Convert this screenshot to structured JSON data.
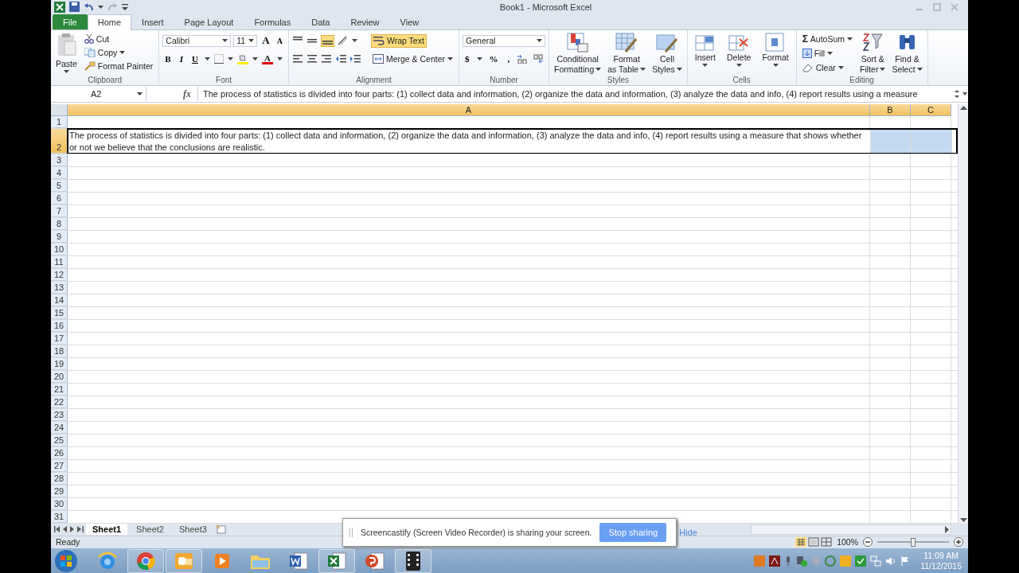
{
  "window": {
    "title": "Book1  -  Microsoft Excel"
  },
  "tabs": [
    {
      "label": "File",
      "kind": "file",
      "selected": false
    },
    {
      "label": "Home",
      "kind": "tab",
      "selected": true
    },
    {
      "label": "Insert",
      "kind": "tab",
      "selected": false
    },
    {
      "label": "Page Layout",
      "kind": "tab",
      "selected": false
    },
    {
      "label": "Formulas",
      "kind": "tab",
      "selected": false
    },
    {
      "label": "Data",
      "kind": "tab",
      "selected": false
    },
    {
      "label": "Review",
      "kind": "tab",
      "selected": false
    },
    {
      "label": "View",
      "kind": "tab",
      "selected": false
    }
  ],
  "ribbon": {
    "groups": [
      {
        "kind": "clipboard",
        "label": "Clipboard",
        "paste": {
          "label": "Paste",
          "disabled": true
        },
        "items": [
          "Cut",
          "Copy",
          "Format Painter"
        ]
      },
      {
        "kind": "font",
        "label": "Font",
        "font_name": "Calibri",
        "font_size": "11",
        "grow": "A",
        "shrink": "A",
        "bold": "B",
        "italic": "I",
        "underline": "U",
        "font_color": "A"
      },
      {
        "kind": "alignment",
        "label": "Alignment",
        "bottom_align_on": true,
        "wrap_text": {
          "label": "Wrap Text",
          "on": true
        },
        "merge": "Merge & Center"
      },
      {
        "kind": "number",
        "label": "Number",
        "format": "General",
        "currency": "$",
        "percent": "%",
        "comma": ","
      },
      {
        "kind": "styles",
        "label": "Styles",
        "items": [
          [
            "Conditional",
            "Formatting"
          ],
          [
            "Format",
            "as Table"
          ],
          [
            "Cell",
            "Styles"
          ]
        ]
      },
      {
        "kind": "cells",
        "label": "Cells",
        "items": [
          "Insert",
          "Delete",
          "Format"
        ]
      },
      {
        "kind": "editing",
        "label": "Editing",
        "sum_symbol": "Σ",
        "small": [
          "AutoSum",
          "Fill",
          "Clear"
        ],
        "large": [
          [
            "Sort &",
            "Filter"
          ],
          [
            "Find &",
            "Select"
          ]
        ]
      }
    ]
  },
  "formula_bar": {
    "name_box": "A2",
    "fx": "fx",
    "formula": "The process of statistics is divided into four parts: (1) collect data and information, (2) organize the data and information, (3) analyze the data and info, (4) report results using a measure"
  },
  "columns": [
    {
      "label": "A",
      "selected": true
    },
    {
      "label": "B",
      "selected": true
    },
    {
      "label": "C",
      "selected": true
    }
  ],
  "rows": [
    {
      "header": "1",
      "selected": false
    },
    {
      "header": "2",
      "selected": true,
      "tall": true,
      "cells": [
        {
          "text": "The process of statistics is divided into four parts: (1) collect data and information, (2) organize the data and information, (3) analyze the data and info, (4) report results using a measure that shows whether or not we believe that the conclusions are realistic.",
          "selected": false
        },
        {
          "selected": true
        },
        {
          "selected": true
        }
      ]
    },
    {
      "header": "3",
      "selected": false
    },
    {
      "header": "4",
      "selected": false
    },
    {
      "header": "5",
      "selected": false
    },
    {
      "header": "6",
      "selected": false
    },
    {
      "header": "7",
      "selected": false
    },
    {
      "header": "8",
      "selected": false
    },
    {
      "header": "9",
      "selected": false
    },
    {
      "header": "10",
      "selected": false
    },
    {
      "header": "11",
      "selected": false
    },
    {
      "header": "12",
      "selected": false
    },
    {
      "header": "13",
      "selected": false
    },
    {
      "header": "14",
      "selected": false
    },
    {
      "header": "15",
      "selected": false
    },
    {
      "header": "16",
      "selected": false
    },
    {
      "header": "17",
      "selected": false
    },
    {
      "header": "18",
      "selected": false
    },
    {
      "header": "19",
      "selected": false
    },
    {
      "header": "20",
      "selected": false
    },
    {
      "header": "21",
      "selected": false
    },
    {
      "header": "22",
      "selected": false
    },
    {
      "header": "23",
      "selected": false
    },
    {
      "header": "24",
      "selected": false
    },
    {
      "header": "25",
      "selected": false
    },
    {
      "header": "26",
      "selected": false
    },
    {
      "header": "27",
      "selected": false
    },
    {
      "header": "28",
      "selected": false
    },
    {
      "header": "29",
      "selected": false
    },
    {
      "header": "30",
      "selected": false
    },
    {
      "header": "31",
      "selected": false
    }
  ],
  "sheet_tabs": [
    {
      "label": "Sheet1",
      "selected": true
    },
    {
      "label": "Sheet2",
      "selected": false
    },
    {
      "label": "Sheet3",
      "selected": false
    }
  ],
  "status_bar": {
    "status": "Ready",
    "zoom": "100%",
    "zoom_slider": {
      "level": 0.5
    }
  },
  "notification": {
    "message": "Screencastify (Screen Video Recorder) is sharing your screen.",
    "buttons": [
      {
        "label": "Stop sharing",
        "kind": "primary"
      },
      {
        "label": "Hide",
        "kind": "link"
      }
    ]
  },
  "taskbar": {
    "apps": [
      {
        "kind": "ie",
        "running": false
      },
      {
        "kind": "chrome",
        "running": true
      },
      {
        "kind": "outlook",
        "running": true
      },
      {
        "kind": "media",
        "running": false
      },
      {
        "kind": "explorer",
        "running": false
      },
      {
        "kind": "word",
        "running": false
      },
      {
        "kind": "excel",
        "running": true
      },
      {
        "kind": "powerpoint",
        "running": false
      },
      {
        "kind": "film",
        "running": true
      }
    ],
    "clock": {
      "time": "11:09 AM",
      "date": "11/12/2015"
    }
  }
}
